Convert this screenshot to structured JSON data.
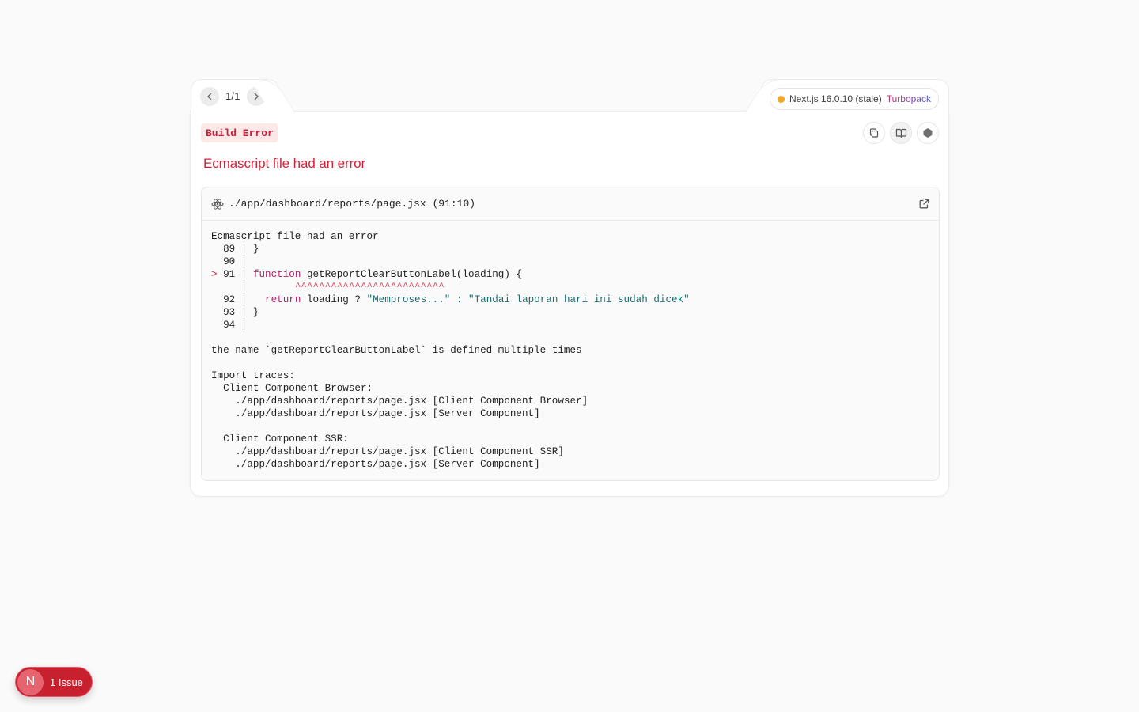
{
  "nav": {
    "counter": "1/1",
    "prev_icon": "chevron-left-icon",
    "next_icon": "chevron-right-icon"
  },
  "version": {
    "status_color": "#f5a623",
    "prefix": "Next.js 16.0.10 (stale)",
    "bundler": "Turbopack"
  },
  "error": {
    "badge": "Build Error",
    "title": "Ecmascript file had an error"
  },
  "toolbar": {
    "copy_icon": "copy-icon",
    "docs_icon": "book-icon",
    "settings_icon": "hexagon-icon"
  },
  "code": {
    "file_path": "./app/dashboard/reports/page.jsx (91:10)",
    "heading": "Ecmascript file had an error",
    "lines": [
      {
        "marker": "  ",
        "num": "89",
        "code": " }"
      },
      {
        "marker": "  ",
        "num": "90",
        "code": ""
      },
      {
        "marker": "> ",
        "num": "91",
        "kw": "function",
        "rest": " getReportClearButtonLabel(loading) {"
      },
      {
        "caret": "^^^^^^^^^^^^^^^^^^^^^^^^^"
      },
      {
        "marker": "  ",
        "num": "92",
        "code2_kw": "return",
        "code2_a": " loading ? ",
        "code2_s1": "\"Memproses...\"",
        "code2_b": " : ",
        "code2_s2": "\"Tandai laporan hari ini sudah dicek\""
      },
      {
        "marker": "  ",
        "num": "93",
        "code": " }"
      },
      {
        "marker": "  ",
        "num": "94",
        "code": ""
      }
    ],
    "message": "the name `getReportClearButtonLabel` is defined multiple times",
    "traces_heading": "Import traces:",
    "trace_groups": [
      {
        "name": "Client Component Browser:",
        "items": [
          "./app/dashboard/reports/page.jsx [Client Component Browser]",
          "./app/dashboard/reports/page.jsx [Server Component]"
        ]
      },
      {
        "name": "Client Component SSR:",
        "items": [
          "./app/dashboard/reports/page.jsx [Client Component SSR]",
          "./app/dashboard/reports/page.jsx [Server Component]"
        ]
      }
    ]
  },
  "indicator": {
    "logo": "N",
    "label": "1 Issue",
    "color": "#c7202f"
  }
}
